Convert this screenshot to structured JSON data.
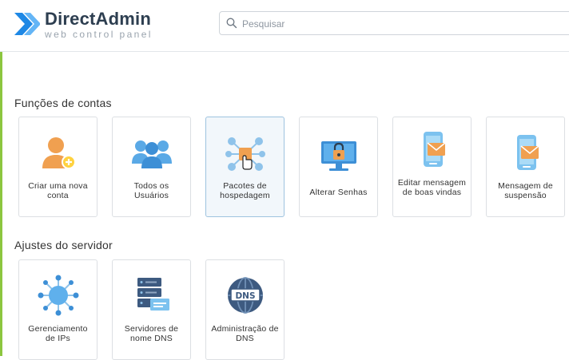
{
  "app": {
    "brand": "DirectAdmin",
    "subtitle": "web control panel"
  },
  "search": {
    "placeholder": "Pesquisar"
  },
  "sections": [
    {
      "title": "Funções de contas",
      "cards": [
        {
          "label": "Criar uma nova conta",
          "icon": "add-user-icon"
        },
        {
          "label": "Todos os Usuários",
          "icon": "users-group-icon"
        },
        {
          "label": "Pacotes de hospedagem",
          "icon": "hosting-packages-icon"
        },
        {
          "label": "Alterar Senhas",
          "icon": "lock-monitor-icon"
        },
        {
          "label": "Editar mensagem de boas vindas",
          "icon": "phone-mail-icon"
        },
        {
          "label": "Mensagem de suspensão",
          "icon": "phone-mail-icon"
        }
      ]
    },
    {
      "title": "Ajustes do servidor",
      "cards": [
        {
          "label": "Gerenciamento de IPs",
          "icon": "ip-network-icon"
        },
        {
          "label": "Servidores de nome DNS",
          "icon": "server-stack-icon"
        },
        {
          "label": "Administração de DNS",
          "icon": "dns-globe-icon"
        }
      ]
    }
  ],
  "colors": {
    "accent_green": "#8cc63f",
    "logo_blue": "#1e88e5",
    "icon_orange": "#f0a050",
    "icon_blue": "#3ea6e6"
  }
}
